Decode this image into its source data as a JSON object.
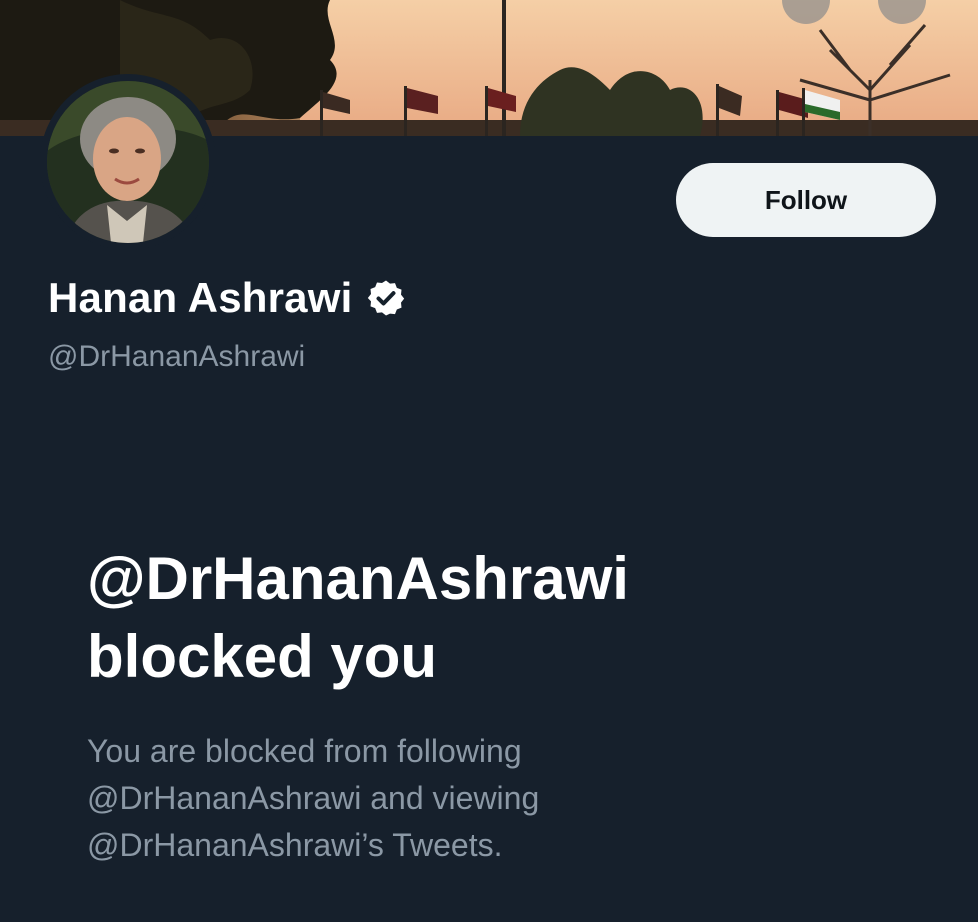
{
  "profile": {
    "display_name": "Hanan Ashrawi",
    "handle": "@DrHananAshrawi",
    "verified": true,
    "verified_icon": "verified-badge-icon"
  },
  "actions": {
    "follow_label": "Follow"
  },
  "blocked": {
    "title_line1": "@DrHananAshrawi",
    "title_line2": "blocked you",
    "desc_line1": "You are blocked from following",
    "desc_line2": "@DrHananAshrawi and viewing",
    "desc_line3": "@DrHananAshrawi’s Tweets."
  },
  "colors": {
    "background": "#15202b",
    "follow_button_bg": "#eff3f4",
    "secondary_text": "#8b98a5"
  }
}
